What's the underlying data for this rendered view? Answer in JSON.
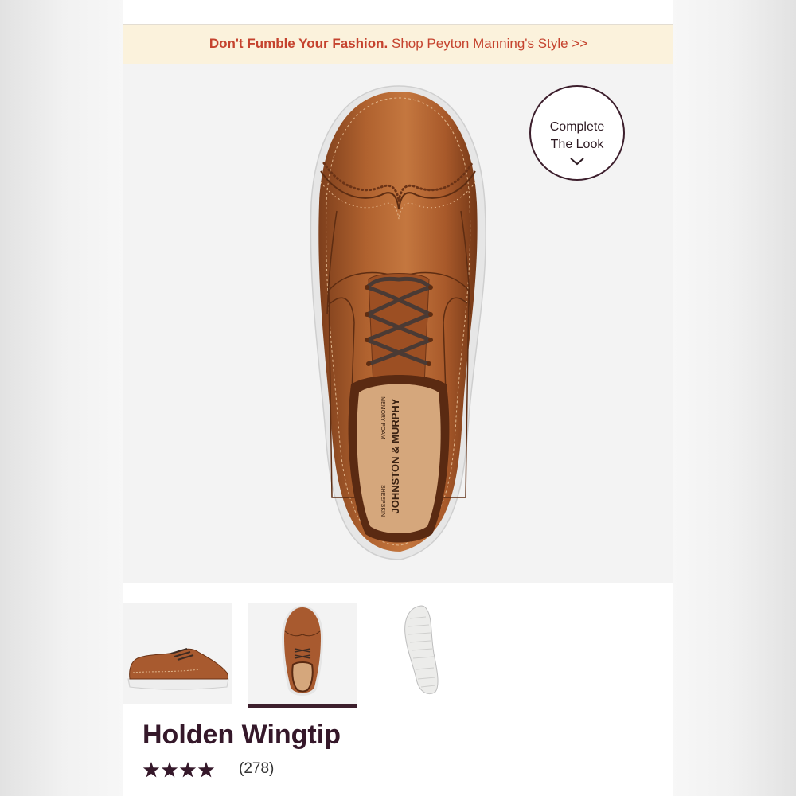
{
  "promo": {
    "lead": "Don't Fumble Your Fashion.",
    "link": "Shop Peyton Manning's Style >>"
  },
  "hero": {
    "complete_look_line1": "Complete",
    "complete_look_line2": "The Look",
    "insole_text": "JOHNSTON & MURPHY",
    "insole_small_1": "MEMORY FOAM",
    "insole_small_2": "SHEEPSKIN"
  },
  "product": {
    "title": "Holden Wingtip",
    "rating": 4.5,
    "rating_max": 5,
    "review_count": "(278)"
  },
  "thumbnails": {
    "selected_index": 2,
    "items": [
      {
        "icon": "shoe-side-view-icon"
      },
      {
        "icon": "shoe-top-view-icon"
      },
      {
        "icon": "shoe-sole-view-icon"
      }
    ]
  },
  "colors": {
    "leather": "#a85a2f",
    "accent_dark": "#3d1f2d",
    "promo_red": "#c5432e",
    "promo_bg": "#fbf2dc"
  }
}
